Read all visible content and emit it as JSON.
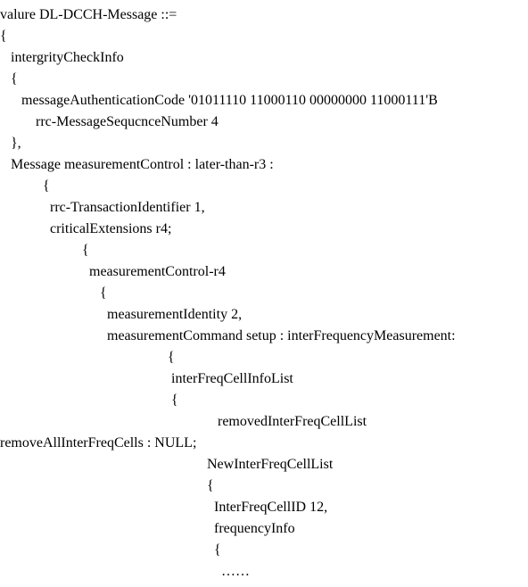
{
  "lines": {
    "l0": "valure DL-DCCH-Message ::=",
    "l1": "{",
    "l2": "   intergrityCheckInfo",
    "l3": "   {",
    "l4": "      messageAuthenticationCode '01011110 11000110 00000000 11000111'B",
    "l5": "          rrc-MessageSequcnceNumber 4",
    "l6": "   },",
    "l7": "   Message measurementControl : later-than-r3 :",
    "l8": "            {",
    "l9": "              rrc-TransactionIdentifier 1,",
    "l10": "              criticalExtensions r4;",
    "l11": "                       {",
    "l12": "                         measurementControl-r4",
    "l13": "                            {",
    "l14": "                              measurementIdentity 2,",
    "l15": "                              measurementCommand setup : interFrequencyMeasurement:",
    "l16": "                                               {",
    "l17": "                                                interFreqCellInfoList",
    "l18": "                                                {",
    "l19": "                                                             removedInterFreqCellList",
    "l20": "removeAllInterFreqCells : NULL;",
    "l21": "                                                          NewInterFreqCellList",
    "l22": "                                                          {",
    "l23": "                                                            InterFreqCellID 12,",
    "l24": "                                                            frequencyInfo",
    "l25": "                                                            {",
    "l26": "                                                              ……"
  }
}
